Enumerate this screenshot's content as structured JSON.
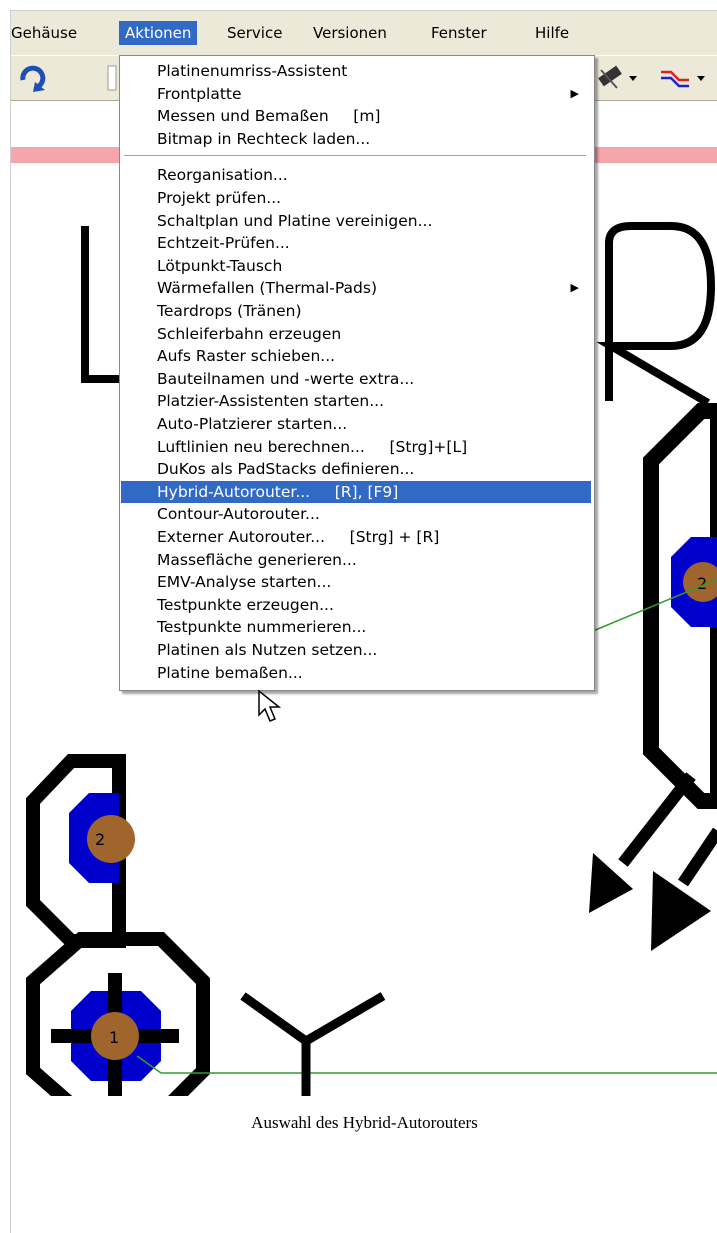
{
  "menubar": {
    "items": [
      "Gehäuse",
      "Aktionen",
      "Service",
      "Versionen",
      "Fenster",
      "Hilfe"
    ]
  },
  "canvas": {
    "pad_labels": [
      "2",
      "2",
      "1"
    ]
  },
  "menu": {
    "group1": [
      {
        "label": "Platinenumriss-Assistent"
      },
      {
        "label": "Frontplatte",
        "submenu": "▶"
      },
      {
        "label": "Messen und Bemaßen     [m]"
      },
      {
        "label": "Bitmap in Rechteck laden..."
      }
    ],
    "group2": [
      {
        "label": "Reorganisation..."
      },
      {
        "label": "Projekt prüfen..."
      },
      {
        "label": "Schaltplan und Platine vereinigen..."
      },
      {
        "label": "Echtzeit-Prüfen..."
      },
      {
        "label": "Lötpunkt-Tausch"
      },
      {
        "label": "Wärmefallen (Thermal-Pads)",
        "submenu": "▶"
      },
      {
        "label": "Teardrops (Tränen)"
      },
      {
        "label": "Schleiferbahn erzeugen"
      },
      {
        "label": "Aufs Raster schieben..."
      },
      {
        "label": "Bauteilnamen und -werte extra..."
      },
      {
        "label": "Platzier-Assistenten starten..."
      },
      {
        "label": "Auto-Platzierer starten..."
      },
      {
        "label": "Luftlinien neu berechnen...     [Strg]+[L]"
      },
      {
        "label": "DuKos als PadStacks definieren..."
      },
      {
        "label": "Hybrid-Autorouter...     [R], [F9]"
      },
      {
        "label": "Contour-Autorouter..."
      },
      {
        "label": "Externer Autorouter...     [Strg] + [R]"
      },
      {
        "label": "Massefläche generieren..."
      },
      {
        "label": "EMV-Analyse starten..."
      },
      {
        "label": "Testpunkte erzeugen..."
      },
      {
        "label": "Testpunkte nummerieren..."
      },
      {
        "label": "Platinen als Nutzen setzen..."
      },
      {
        "label": "Platine bemaßen..."
      }
    ]
  },
  "caption": "Auswahl des Hybrid-Autorouters",
  "colors": {
    "menu_highlight": "#316ac5",
    "chrome": "#ece9d8",
    "pad_blue": "#0000cc",
    "pad_brown": "#a0642d",
    "airwire": "#2e9e2e",
    "pink_bar": "#f5a6ad"
  }
}
